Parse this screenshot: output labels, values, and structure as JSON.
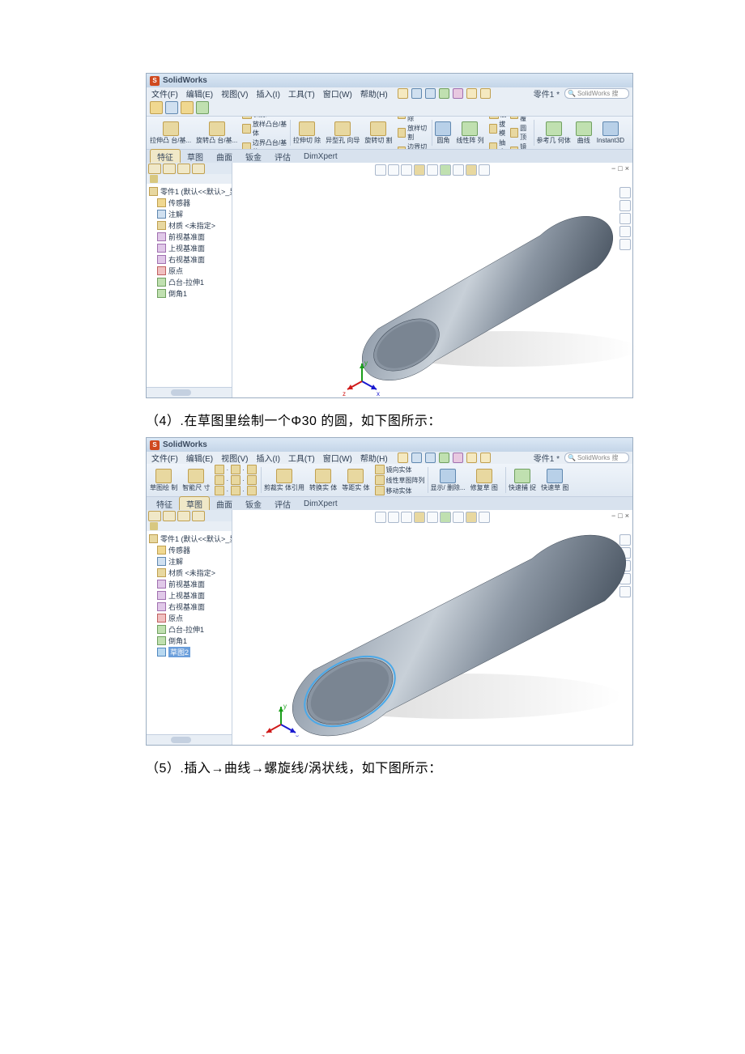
{
  "captions": {
    "c4": "（4）.在草图里绘制一个Φ30 的圆，如下图所示：",
    "c5": "（5）.插入→曲线→螺旋线/涡状线，如下图所示："
  },
  "sw": {
    "brand": "SolidWorks",
    "menus": {
      "file": "文件(F)",
      "edit": "编辑(E)",
      "view": "视图(V)",
      "insert": "插入(I)",
      "tools": "工具(T)",
      "window": "窗口(W)",
      "help": "帮助(H)"
    },
    "docname": "零件1 *",
    "search": "SolidWorks 搜",
    "ribbon1": {
      "extrude": "拉伸凸\n台/基...",
      "revolve": "旋转凸\n台/基...",
      "sweep": "扫掠",
      "loft": "放样凸台/基体",
      "boundary": "边界凸台/基体",
      "cutExtrude": "拉伸切\n除",
      "hole": "异型孔\n向导",
      "cutRevolve": "旋转切\n割",
      "cutSweep": "扫描切除",
      "cutLoft": "放样切割",
      "cutBoundary": "边界切除",
      "fillet": "圆角",
      "pattern": "线性阵\n列",
      "rib": "筋",
      "draft": "拔模",
      "shell": "抽壳",
      "wrap": "包覆",
      "dome": "圆顶",
      "mirror": "镜向",
      "refgeo": "参考几\n何体",
      "curves": "曲线",
      "instant": "Instant3D"
    },
    "ribbon2": {
      "sketch": "草图绘\n制",
      "dim": "智能尺\n寸",
      "trim": "剪裁实\n体引用",
      "convert": "转换实\n体",
      "offset": "等距实\n体",
      "mirror": "镜向实体",
      "pattern": "线性草图阵列",
      "move": "移动实体",
      "display": "显示/\n删除...",
      "repair": "修复草\n图",
      "snap": "快速捕\n捉",
      "rapid": "快速草\n图"
    },
    "tabs": {
      "feat": "特征",
      "sketch": "草图",
      "surf": "曲面",
      "sheet": "钣金",
      "eval": "评估",
      "dx": "DimXpert"
    },
    "tree": {
      "root": "零件1 (默认<<默认>_显",
      "sensor": "传感器",
      "annot": "注解",
      "material": "材质 <未指定>",
      "front": "前视基准面",
      "top": "上视基准面",
      "right": "右视基准面",
      "origin": "原点",
      "extrude": "凸台-拉伸1",
      "chamfer": "倒角1",
      "sketch2": "草图2"
    },
    "wincontrols": {
      "min": "−",
      "max": "□",
      "close": "×"
    }
  }
}
